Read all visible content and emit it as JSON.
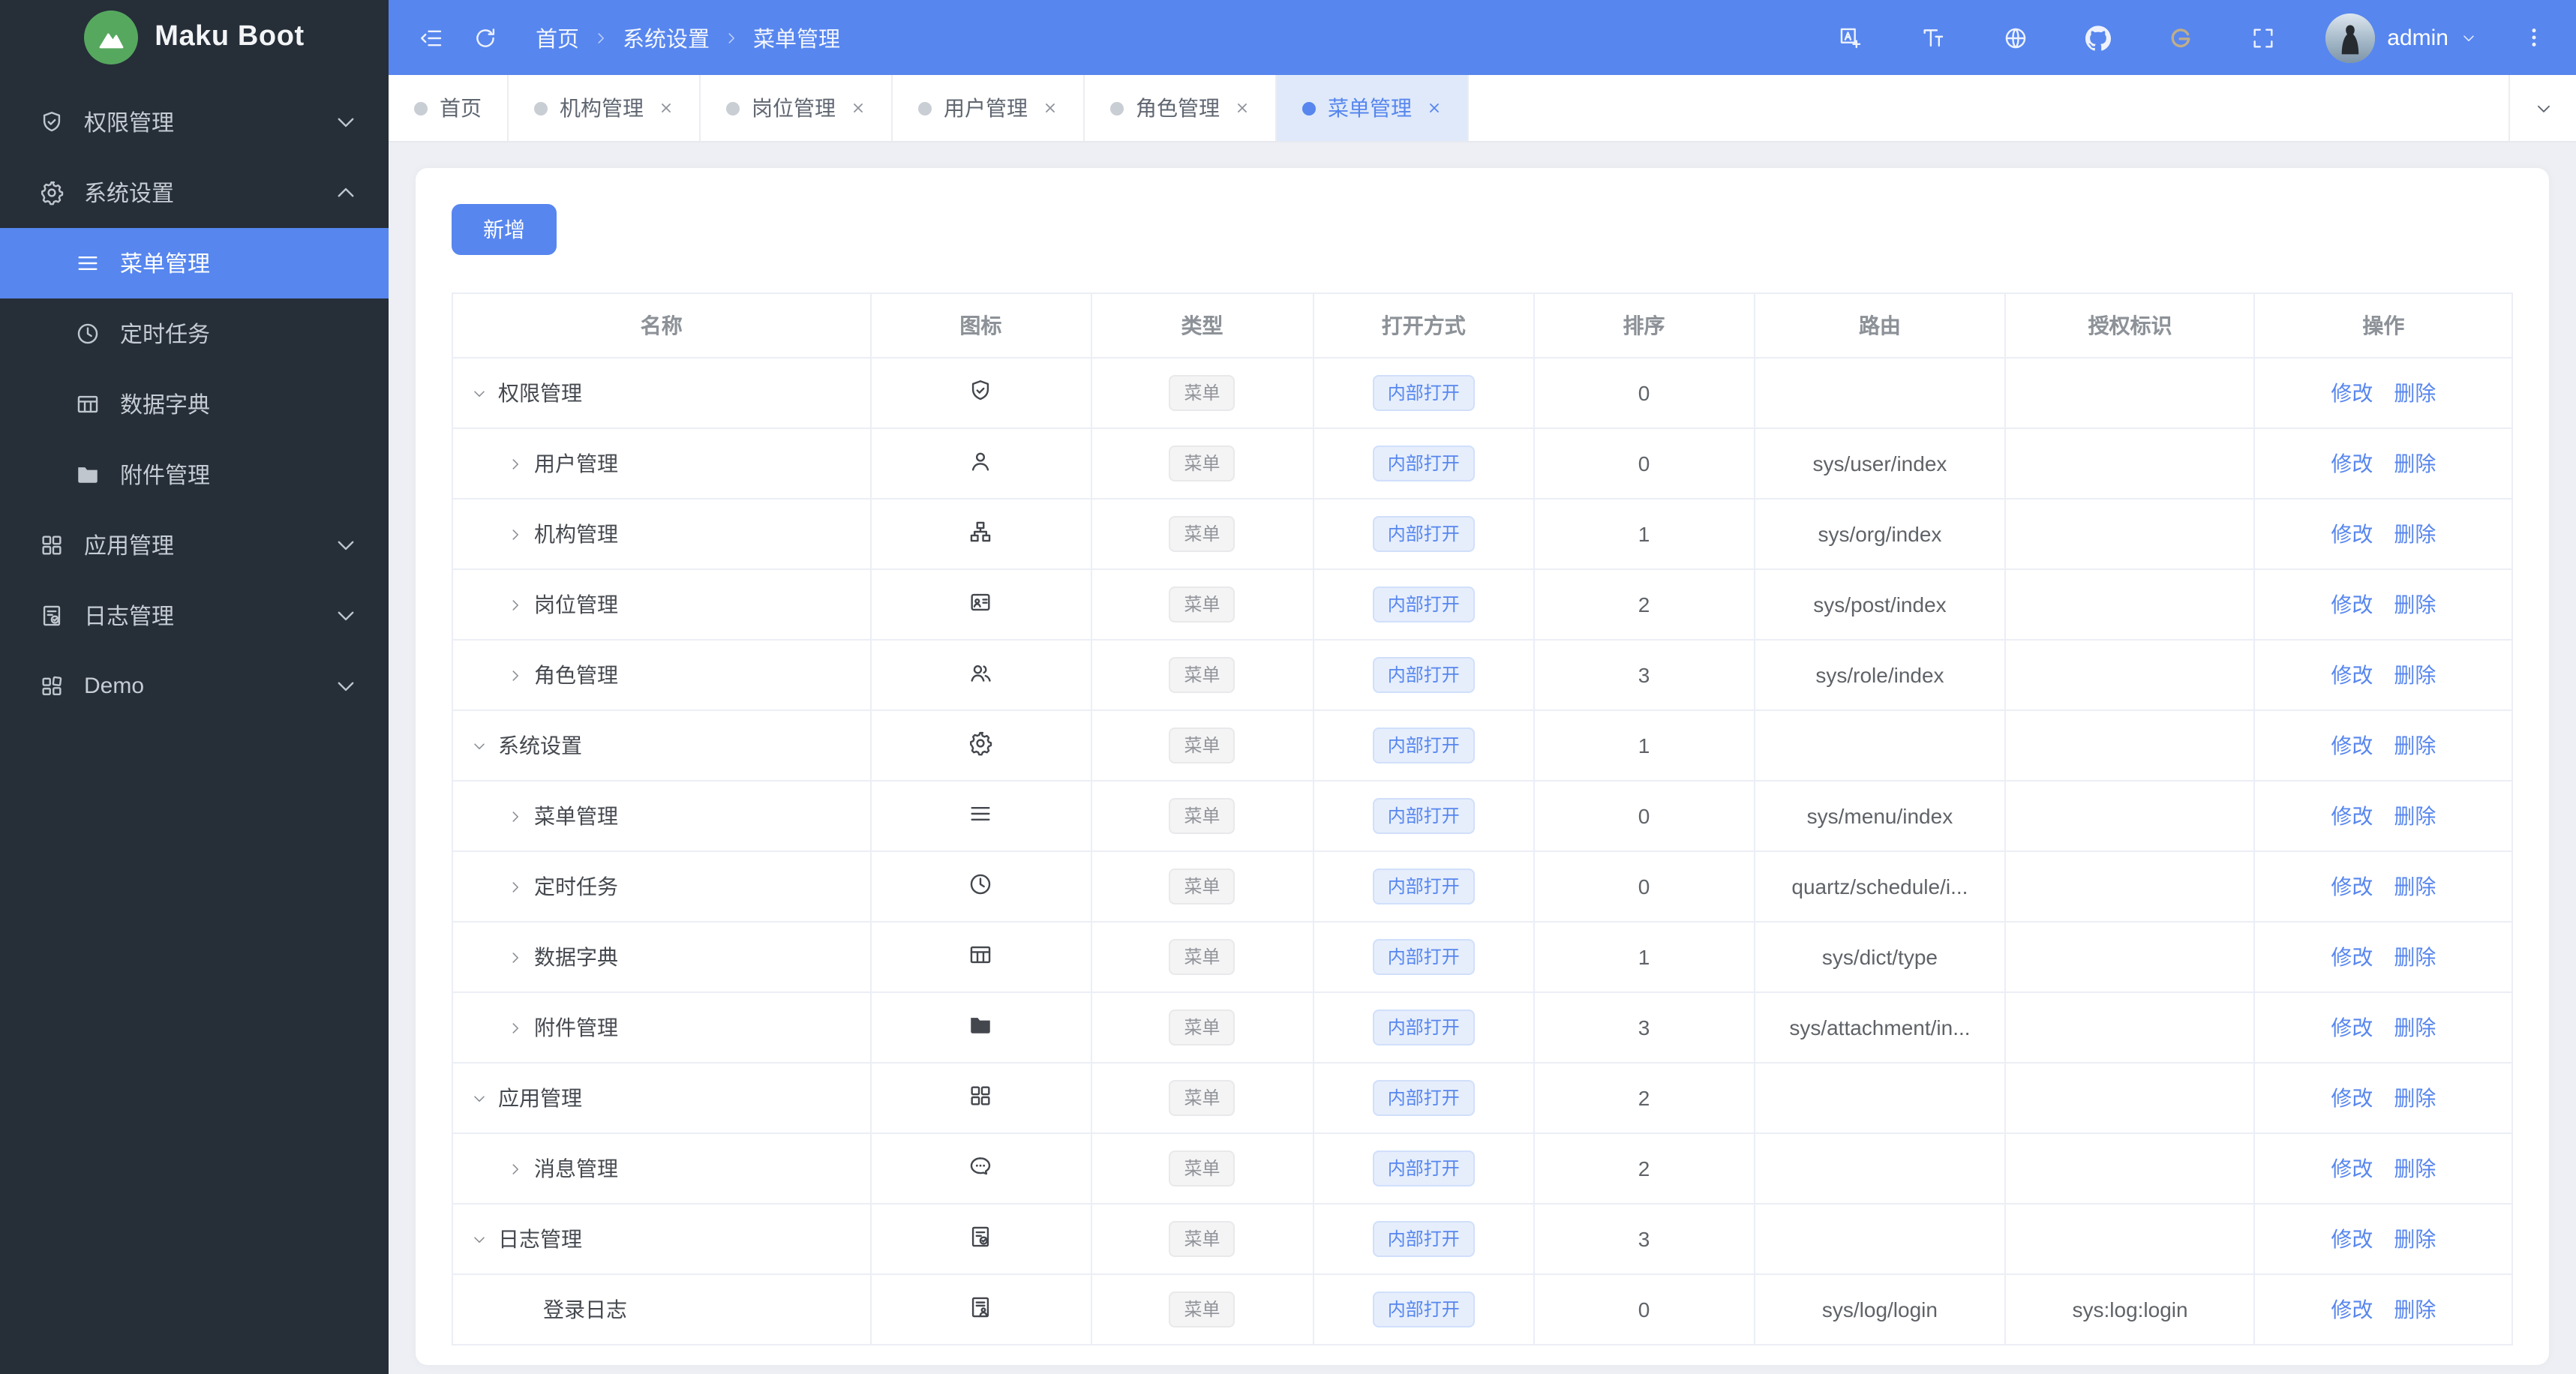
{
  "app": {
    "title": "Maku Boot"
  },
  "colors": {
    "primary": "#5786ee",
    "topbar_bg": "#5786ee",
    "sidebar_bg": "#262e38",
    "logo_green": "#56a85f",
    "tab_active_bg": "#dfe9fa",
    "page_bg": "#edeff4",
    "table_border": "#ebeef5",
    "tag_info_text": "#909399",
    "gitee_gold": "#c0ad89"
  },
  "topbar": {
    "left_icons": [
      {
        "key": "collapse",
        "icon": "collapse-sidebar-icon"
      },
      {
        "key": "refresh",
        "icon": "refresh-icon"
      }
    ],
    "breadcrumb": [
      "首页",
      "系统设置",
      "菜单管理"
    ],
    "right_icons": [
      {
        "key": "translate",
        "icon": "translate-icon"
      },
      {
        "key": "font-size",
        "icon": "font-size-icon"
      },
      {
        "key": "globe",
        "icon": "globe-icon"
      },
      {
        "key": "github",
        "icon": "github-icon"
      },
      {
        "key": "gitee",
        "icon": "gitee-icon"
      },
      {
        "key": "fullscreen",
        "icon": "fullscreen-icon"
      }
    ],
    "user": "admin"
  },
  "sidebar": {
    "items": [
      {
        "key": "permission",
        "label": "权限管理",
        "icon": "shield-check-icon",
        "chevron": "down"
      },
      {
        "key": "system",
        "label": "系统设置",
        "icon": "gear-icon",
        "chevron": "up",
        "expanded": true,
        "children": [
          {
            "key": "menu",
            "label": "菜单管理",
            "icon": "menu-icon",
            "active": true
          },
          {
            "key": "schedule",
            "label": "定时任务",
            "icon": "clock-icon"
          },
          {
            "key": "dict",
            "label": "数据字典",
            "icon": "dict-table-icon"
          },
          {
            "key": "attachment",
            "label": "附件管理",
            "icon": "folder-icon"
          }
        ]
      },
      {
        "key": "app",
        "label": "应用管理",
        "icon": "app-grid-icon",
        "chevron": "down"
      },
      {
        "key": "log",
        "label": "日志管理",
        "icon": "log-doc-icon",
        "chevron": "down"
      },
      {
        "key": "demo",
        "label": "Demo",
        "icon": "demo-grid-icon",
        "chevron": "down"
      }
    ]
  },
  "tabs": [
    {
      "key": "home",
      "label": "首页",
      "closable": false,
      "active": false
    },
    {
      "key": "org",
      "label": "机构管理",
      "closable": true,
      "active": false
    },
    {
      "key": "post",
      "label": "岗位管理",
      "closable": true,
      "active": false
    },
    {
      "key": "user",
      "label": "用户管理",
      "closable": true,
      "active": false
    },
    {
      "key": "role",
      "label": "角色管理",
      "closable": true,
      "active": false
    },
    {
      "key": "menu",
      "label": "菜单管理",
      "closable": true,
      "active": true
    }
  ],
  "toolbar": {
    "add_label": "新增"
  },
  "table": {
    "columns": [
      "名称",
      "图标",
      "类型",
      "打开方式",
      "排序",
      "路由",
      "授权标识",
      "操作"
    ],
    "col_widths": [
      "20.3%",
      "10.7%",
      "10.8%",
      "10.7%",
      "10.7%",
      "12.2%",
      "12.1%",
      "12.5%"
    ],
    "actions": [
      "修改",
      "删除"
    ],
    "rows": [
      {
        "name": "权限管理",
        "icon": "shield-check-icon",
        "level": 0,
        "expand": "down",
        "type": "菜单",
        "open": "内部打开",
        "sort": "0",
        "route": "",
        "auth": ""
      },
      {
        "name": "用户管理",
        "icon": "user-icon",
        "level": 1,
        "expand": "right",
        "type": "菜单",
        "open": "内部打开",
        "sort": "0",
        "route": "sys/user/index",
        "auth": ""
      },
      {
        "name": "机构管理",
        "icon": "org-icon",
        "level": 1,
        "expand": "right",
        "type": "菜单",
        "open": "内部打开",
        "sort": "1",
        "route": "sys/org/index",
        "auth": ""
      },
      {
        "name": "岗位管理",
        "icon": "post-card-icon",
        "level": 1,
        "expand": "right",
        "type": "菜单",
        "open": "内部打开",
        "sort": "2",
        "route": "sys/post/index",
        "auth": ""
      },
      {
        "name": "角色管理",
        "icon": "role-users-icon",
        "level": 1,
        "expand": "right",
        "type": "菜单",
        "open": "内部打开",
        "sort": "3",
        "route": "sys/role/index",
        "auth": ""
      },
      {
        "name": "系统设置",
        "icon": "gear-icon",
        "level": 0,
        "expand": "down",
        "type": "菜单",
        "open": "内部打开",
        "sort": "1",
        "route": "",
        "auth": ""
      },
      {
        "name": "菜单管理",
        "icon": "menu-icon",
        "level": 1,
        "expand": "right",
        "type": "菜单",
        "open": "内部打开",
        "sort": "0",
        "route": "sys/menu/index",
        "auth": ""
      },
      {
        "name": "定时任务",
        "icon": "clock-icon",
        "level": 1,
        "expand": "right",
        "type": "菜单",
        "open": "内部打开",
        "sort": "0",
        "route": "quartz/schedule/i...",
        "auth": ""
      },
      {
        "name": "数据字典",
        "icon": "dict-table-icon",
        "level": 1,
        "expand": "right",
        "type": "菜单",
        "open": "内部打开",
        "sort": "1",
        "route": "sys/dict/type",
        "auth": ""
      },
      {
        "name": "附件管理",
        "icon": "folder-icon",
        "level": 1,
        "expand": "right",
        "type": "菜单",
        "open": "内部打开",
        "sort": "3",
        "route": "sys/attachment/in...",
        "auth": ""
      },
      {
        "name": "应用管理",
        "icon": "app-grid-icon",
        "level": 0,
        "expand": "down",
        "type": "菜单",
        "open": "内部打开",
        "sort": "2",
        "route": "",
        "auth": ""
      },
      {
        "name": "消息管理",
        "icon": "message-icon",
        "level": 1,
        "expand": "right",
        "type": "菜单",
        "open": "内部打开",
        "sort": "2",
        "route": "",
        "auth": ""
      },
      {
        "name": "日志管理",
        "icon": "log-doc-icon",
        "level": 0,
        "expand": "down",
        "type": "菜单",
        "open": "内部打开",
        "sort": "3",
        "route": "",
        "auth": ""
      },
      {
        "name": "登录日志",
        "icon": "login-log-icon",
        "level": 2,
        "expand": "none",
        "type": "菜单",
        "open": "内部打开",
        "sort": "0",
        "route": "sys/log/login",
        "auth": "sys:log:login"
      }
    ]
  }
}
